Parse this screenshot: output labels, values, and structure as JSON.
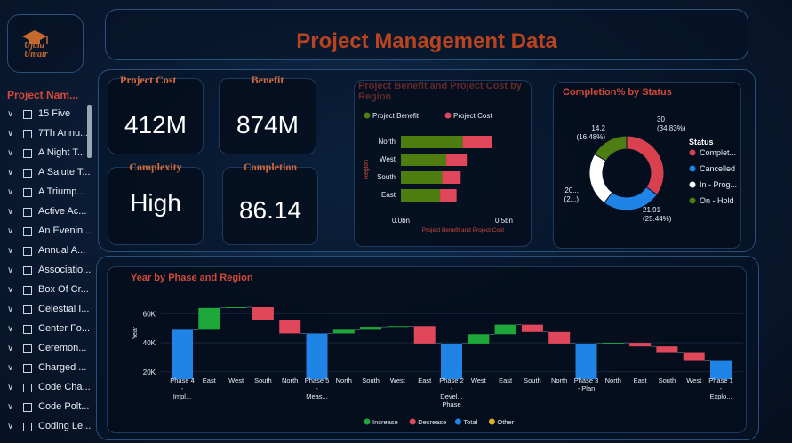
{
  "header": {
    "title": "Project Management Data",
    "logo_text": "Ujala\nUmair"
  },
  "slicer": {
    "title": "Project Nam...",
    "items": [
      "15 Five",
      "7Th Annu...",
      "A Night T...",
      "A Salute T...",
      "A Triump...",
      "Active Ac...",
      "An Evenin...",
      "Annual A...",
      "Associatio...",
      "Box Of Cr...",
      "Celestial I...",
      "Center Fo...",
      "Ceremon...",
      "Charged ...",
      "Code Cha...",
      "Code Polt...",
      "Coding Le..."
    ]
  },
  "kpis": {
    "cost": {
      "title": "Project Cost",
      "value": "412M"
    },
    "benefit": {
      "title": "Benefit",
      "value": "874M"
    },
    "complexity": {
      "title": "Complexity",
      "value": "High"
    },
    "completion": {
      "title": "Completion",
      "value": "86.14"
    }
  },
  "chart_data": [
    {
      "type": "bar",
      "title": "Project Benefit and Project Cost by Region",
      "orientation": "horizontal-stacked",
      "xlabel": "Project Benefit and Project Cost",
      "ylabel": "Region",
      "categories": [
        "North",
        "West",
        "South",
        "East"
      ],
      "series": [
        {
          "name": "Project Benefit",
          "color": "#4e7d12",
          "values": [
            0.3,
            0.22,
            0.2,
            0.19
          ]
        },
        {
          "name": "Project Cost",
          "color": "#e0475a",
          "values": [
            0.14,
            0.1,
            0.09,
            0.08
          ]
        }
      ],
      "xticks": [
        "0.0bn",
        "0.5bn"
      ],
      "xlim": [
        0,
        0.5
      ],
      "legend": "top"
    },
    {
      "type": "pie",
      "title": "Completion% by Status",
      "legend_title": "Status",
      "legend": "right",
      "slices": [
        {
          "name": "Complet...",
          "value": 30,
          "pct": 34.83,
          "color": "#d9414f",
          "label": "30",
          "pct_label": "(34.83%)"
        },
        {
          "name": "Cancelled",
          "value": 21.91,
          "pct": 25.44,
          "color": "#1f84e6",
          "label": "21.91",
          "pct_label": "(25.44%)"
        },
        {
          "name": "In - Prog...",
          "value": 20,
          "pct": 23.26,
          "color": "#ffffff",
          "label": "20...",
          "pct_label": "(2...)"
        },
        {
          "name": "On - Hold",
          "value": 14.2,
          "pct": 16.48,
          "color": "#4e7d12",
          "label": "14.2",
          "pct_label": "(16.48%)"
        }
      ]
    },
    {
      "type": "waterfall",
      "title": "Year by Phase and Region",
      "ylabel": "Year",
      "ylim": [
        15000,
        70000
      ],
      "yticks": [
        20000,
        40000,
        60000
      ],
      "ytick_labels": [
        "20K",
        "40K",
        "60K"
      ],
      "legend": "bottom",
      "legend_items": [
        {
          "name": "Increase",
          "color": "#1fa83a"
        },
        {
          "name": "Decrease",
          "color": "#e0475a"
        },
        {
          "name": "Total",
          "color": "#1f84e6"
        },
        {
          "name": "Other",
          "color": "#e0b020"
        }
      ],
      "steps": [
        {
          "label": "Phase 4 - Impl...",
          "kind": "total",
          "start": 0,
          "end": 49000
        },
        {
          "label": "East",
          "kind": "increase",
          "start": 49000,
          "end": 64000
        },
        {
          "label": "West",
          "kind": "increase",
          "start": 64000,
          "end": 64500
        },
        {
          "label": "South",
          "kind": "decrease",
          "start": 64500,
          "end": 55500
        },
        {
          "label": "North",
          "kind": "decrease",
          "start": 55500,
          "end": 46500
        },
        {
          "label": "Phase 5 - Meas...",
          "kind": "total",
          "start": 0,
          "end": 46500
        },
        {
          "label": "North",
          "kind": "increase",
          "start": 46500,
          "end": 49000
        },
        {
          "label": "South",
          "kind": "increase",
          "start": 49000,
          "end": 51000
        },
        {
          "label": "West",
          "kind": "increase",
          "start": 51000,
          "end": 51500
        },
        {
          "label": "East",
          "kind": "decrease",
          "start": 51500,
          "end": 39500
        },
        {
          "label": "Phase 2 - Devel... Phase",
          "kind": "total",
          "start": 0,
          "end": 39500
        },
        {
          "label": "West",
          "kind": "increase",
          "start": 39500,
          "end": 46000
        },
        {
          "label": "East",
          "kind": "increase",
          "start": 46000,
          "end": 52500
        },
        {
          "label": "South",
          "kind": "decrease",
          "start": 52500,
          "end": 47500
        },
        {
          "label": "North",
          "kind": "decrease",
          "start": 47500,
          "end": 39500
        },
        {
          "label": "Phase 3 - Plan",
          "kind": "total",
          "start": 0,
          "end": 39500
        },
        {
          "label": "North",
          "kind": "increase",
          "start": 39500,
          "end": 40000
        },
        {
          "label": "East",
          "kind": "decrease",
          "start": 40000,
          "end": 37500
        },
        {
          "label": "South",
          "kind": "decrease",
          "start": 37500,
          "end": 33000
        },
        {
          "label": "West",
          "kind": "decrease",
          "start": 33000,
          "end": 27500
        },
        {
          "label": "Phase 1 - Explo...",
          "kind": "total",
          "start": 0,
          "end": 27500
        }
      ]
    }
  ]
}
